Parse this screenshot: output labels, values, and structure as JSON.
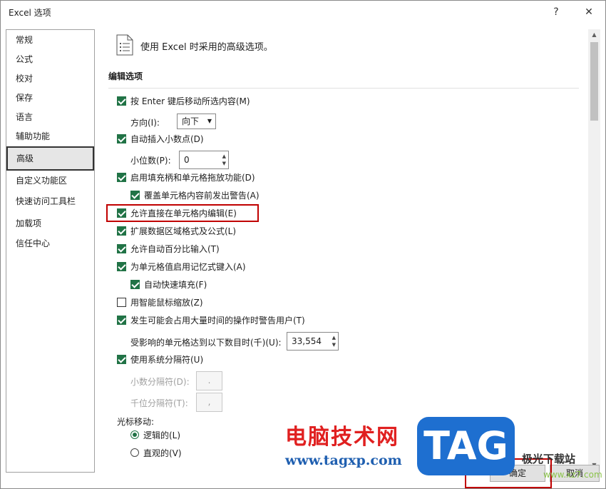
{
  "window": {
    "title": "Excel 选项",
    "help_label": "?",
    "close_label": "✕"
  },
  "sidebar": {
    "items": [
      {
        "label": "常规"
      },
      {
        "label": "公式"
      },
      {
        "label": "校对"
      },
      {
        "label": "保存"
      },
      {
        "label": "语言"
      },
      {
        "label": "辅助功能"
      },
      {
        "label": "高级",
        "selected": true
      },
      {
        "label": "自定义功能区"
      },
      {
        "label": "快速访问工具栏"
      },
      {
        "label": "加载项"
      },
      {
        "label": "信任中心"
      }
    ]
  },
  "header": {
    "icon": "document-options-icon",
    "text": "使用 Excel 时采用的高级选项。"
  },
  "editing": {
    "title": "编辑选项",
    "move_after_enter": {
      "label": "按 Enter 键后移动所选内容(M)",
      "checked": true
    },
    "direction": {
      "label": "方向(I):",
      "value": "向下"
    },
    "auto_decimal": {
      "label": "自动插入小数点(D)",
      "checked": true
    },
    "places": {
      "label": "小位数(P):",
      "value": "0"
    },
    "fill_handle": {
      "label": "启用填充柄和单元格拖放功能(D)",
      "checked": true
    },
    "alert_overwrite": {
      "label": "覆盖单元格内容前发出警告(A)",
      "checked": true
    },
    "edit_in_cell": {
      "label": "允许直接在单元格内编辑(E)",
      "checked": true
    },
    "extend_formats": {
      "label": "扩展数据区域格式及公式(L)",
      "checked": true
    },
    "auto_percent": {
      "label": "允许自动百分比输入(T)",
      "checked": true
    },
    "autocomplete": {
      "label": "为单元格值启用记忆式键入(A)",
      "checked": true
    },
    "flash_fill": {
      "label": "自动快速填充(F)",
      "checked": true
    },
    "zoom_roll": {
      "label": "用智能鼠标缩放(Z)",
      "checked": false
    },
    "alert_time": {
      "label": "发生可能会占用大量时间的操作时警告用户(T)",
      "checked": true
    },
    "cells_affected": {
      "label": "受影响的单元格达到以下数目时(千)(U):",
      "value": "33,554"
    },
    "system_separators": {
      "label": "使用系统分隔符(U)",
      "checked": true
    },
    "decimal_separator": {
      "label": "小数分隔符(D):",
      "value": "."
    },
    "thousands_separator": {
      "label": "千位分隔符(T):",
      "value": ","
    },
    "cursor_movement": {
      "label": "光标移动:"
    },
    "logical": {
      "label": "逻辑的(L)",
      "selected": true
    },
    "visual": {
      "label": "直观的(V)",
      "selected": false
    }
  },
  "footer": {
    "ok_label": "确定",
    "cancel_label": "取消"
  },
  "watermark": {
    "site_name": "电脑技术网",
    "url": "www.tagxp.com",
    "logo_text": "TAG",
    "brand2": "极光下载站",
    "brand2_url": "www.xz7.com"
  },
  "colors": {
    "accent": "#217346",
    "highlight": "#c00000"
  }
}
